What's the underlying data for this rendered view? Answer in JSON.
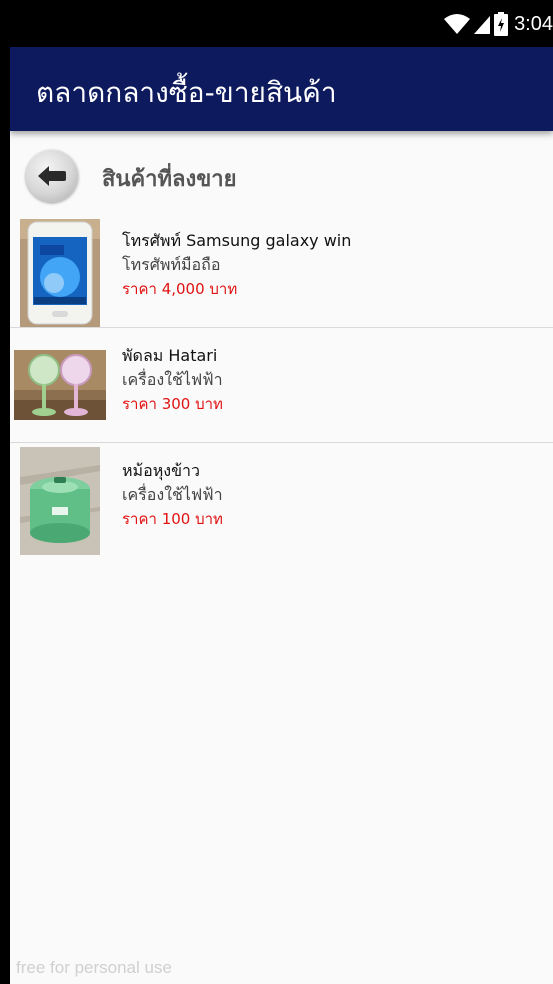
{
  "status_bar": {
    "time": "3:04",
    "icons": [
      "wifi-icon",
      "cellular-signal-icon",
      "battery-icon"
    ]
  },
  "app_bar": {
    "title": "ตลาดกลางซื้อ-ขายสินค้า",
    "color": "#0e1a5e"
  },
  "section": {
    "back_icon": "back-arrow-icon",
    "title": "สินค้าที่ลงขาย"
  },
  "products": [
    {
      "name": "โทรศัพท์ Samsung galaxy win",
      "category": "โทรศัพท์มือถือ",
      "price": "ราคา 4,000 บาท",
      "image": "smartphone-photo"
    },
    {
      "name": "พัดลม Hatari",
      "category": "เครื่องใช้ไฟฟ้า",
      "price": "ราคา 300 บาท",
      "image": "electric-fans-photo"
    },
    {
      "name": "หม้อหุงข้าว",
      "category": "เครื่องใช้ไฟฟ้า",
      "price": "ราคา 100 บาท",
      "image": "rice-cooker-photo"
    }
  ],
  "watermark": "free for personal use",
  "colors": {
    "price": "#e01212",
    "app_bar": "#0e1a5e",
    "background": "#fafafa"
  }
}
